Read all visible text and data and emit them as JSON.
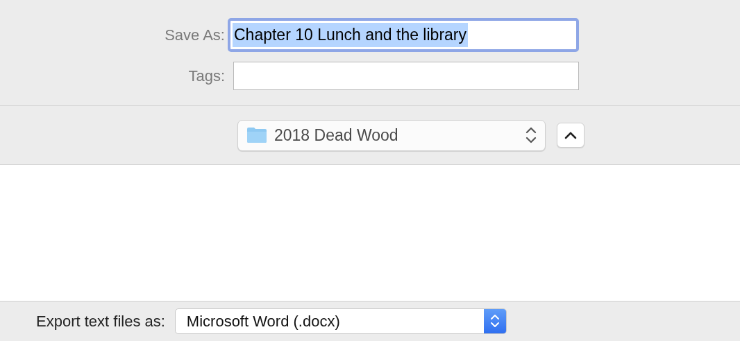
{
  "save_as": {
    "label": "Save As:",
    "value": "Chapter 10 Lunch and the library",
    "focused": true,
    "text_selected": true
  },
  "tags": {
    "label": "Tags:"
  },
  "location": {
    "folder": "2018 Dead Wood"
  },
  "export": {
    "label": "Export text files as:",
    "value": "Microsoft Word (.docx)"
  }
}
